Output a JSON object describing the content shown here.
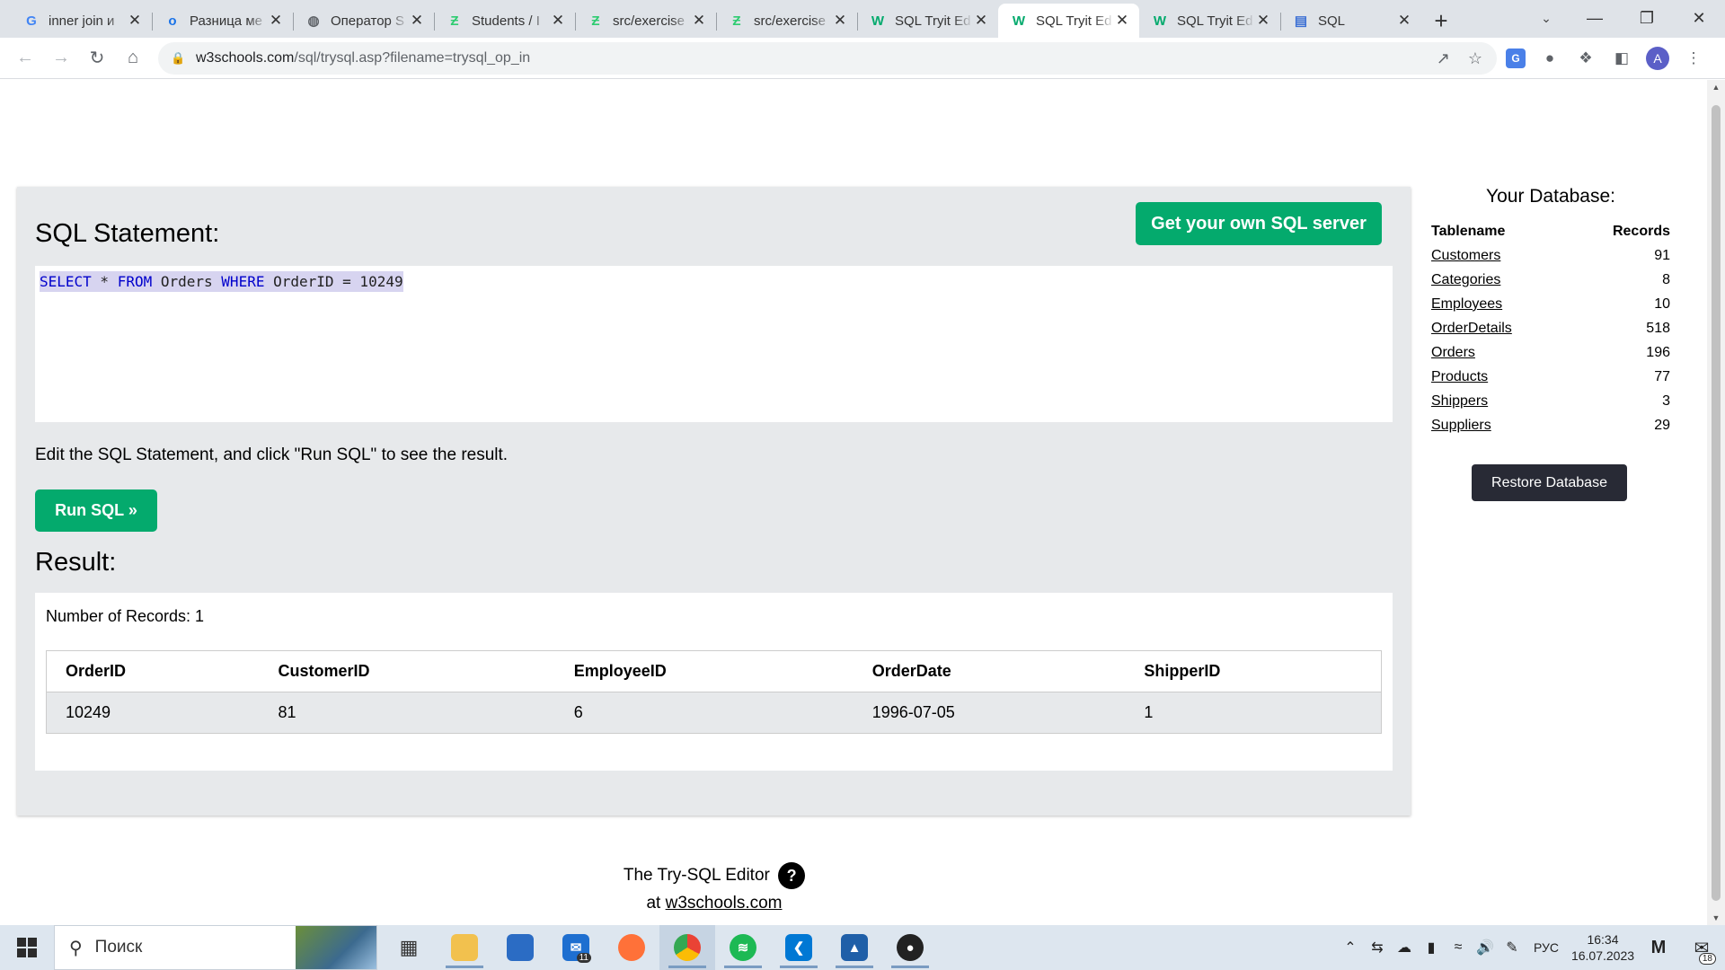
{
  "browser": {
    "tabs": [
      {
        "title": "inner join и",
        "icon": "google-icon",
        "color": "#4285f4"
      },
      {
        "title": "Разница ме",
        "icon": "otvet-icon",
        "color": "#1a73e8"
      },
      {
        "title": "Оператор S",
        "icon": "globe-icon",
        "color": "#5f6368"
      },
      {
        "title": "Students / I",
        "icon": "hexlet-icon",
        "color": "#2ecc71"
      },
      {
        "title": "src/exercise",
        "icon": "hexlet-icon",
        "color": "#2ecc71"
      },
      {
        "title": "src/exercise",
        "icon": "hexlet-icon",
        "color": "#2ecc71"
      },
      {
        "title": "SQL Tryit Ed",
        "icon": "w3schools-icon",
        "color": "#04aa6d"
      },
      {
        "title": "SQL Tryit Ed",
        "icon": "w3schools-icon",
        "color": "#04aa6d",
        "active": true
      },
      {
        "title": "SQL Tryit Ed",
        "icon": "w3schools-icon",
        "color": "#04aa6d"
      },
      {
        "title": "SQL",
        "icon": "doc-icon",
        "color": "#3b6fd4"
      }
    ],
    "url_host": "w3schools.com",
    "url_path": "/sql/trysql.asp?filename=trysql_op_in"
  },
  "editor": {
    "heading": "SQL Statement:",
    "get_server_label": "Get your own SQL server",
    "code": {
      "kw1": "SELECT",
      "t1": " * ",
      "kw2": "FROM",
      "t2": " Orders ",
      "kw3": "WHERE",
      "t3": " OrderID = 10249"
    },
    "hint": "Edit the SQL Statement, and click \"Run SQL\" to see the result.",
    "run_label": "Run SQL »",
    "result_heading": "Result:",
    "record_count": "Number of Records: 1",
    "columns": [
      "OrderID",
      "CustomerID",
      "EmployeeID",
      "OrderDate",
      "ShipperID"
    ],
    "rows": [
      [
        "10249",
        "81",
        "6",
        "1996-07-05",
        "1"
      ]
    ]
  },
  "database": {
    "title": "Your Database:",
    "col_name": "Tablename",
    "col_records": "Records",
    "tables": [
      {
        "name": "Customers",
        "records": "91"
      },
      {
        "name": "Categories",
        "records": "8"
      },
      {
        "name": "Employees",
        "records": "10"
      },
      {
        "name": "OrderDetails",
        "records": "518"
      },
      {
        "name": "Orders",
        "records": "196"
      },
      {
        "name": "Products",
        "records": "77"
      },
      {
        "name": "Shippers",
        "records": "3"
      },
      {
        "name": "Suppliers",
        "records": "29"
      }
    ],
    "restore_label": "Restore Database"
  },
  "footer": {
    "line1": "The Try-SQL Editor",
    "help_glyph": "?",
    "at": "at ",
    "link": "w3schools.com"
  },
  "taskbar": {
    "search_label": "Поиск",
    "mail_badge": "11",
    "lang": "РУС",
    "time": "16:34",
    "date": "16.07.2023",
    "notif_count": "18"
  },
  "colors": {
    "accent_green": "#04aa6d",
    "panel_gray": "#e7e9eb",
    "dark_button": "#282a35"
  }
}
